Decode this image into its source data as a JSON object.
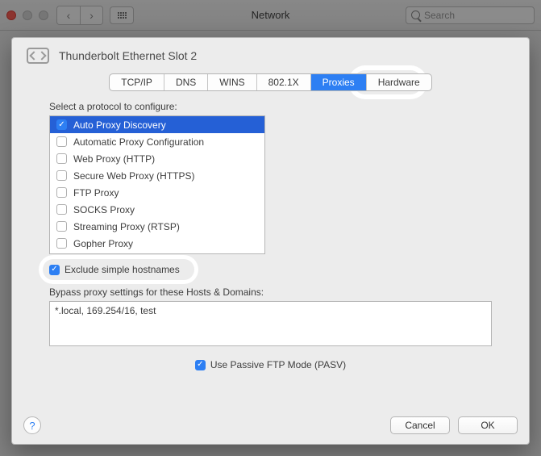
{
  "window": {
    "title": "Network",
    "search_placeholder": "Search"
  },
  "sheet": {
    "title": "Thunderbolt Ethernet Slot 2"
  },
  "tabs": [
    "TCP/IP",
    "DNS",
    "WINS",
    "802.1X",
    "Proxies",
    "Hardware"
  ],
  "active_tab": "Proxies",
  "protocol_label": "Select a protocol to configure:",
  "protocols": [
    {
      "label": "Auto Proxy Discovery",
      "checked": true,
      "selected": true
    },
    {
      "label": "Automatic Proxy Configuration",
      "checked": false,
      "selected": false
    },
    {
      "label": "Web Proxy (HTTP)",
      "checked": false,
      "selected": false
    },
    {
      "label": "Secure Web Proxy (HTTPS)",
      "checked": false,
      "selected": false
    },
    {
      "label": "FTP Proxy",
      "checked": false,
      "selected": false
    },
    {
      "label": "SOCKS Proxy",
      "checked": false,
      "selected": false
    },
    {
      "label": "Streaming Proxy (RTSP)",
      "checked": false,
      "selected": false
    },
    {
      "label": "Gopher Proxy",
      "checked": false,
      "selected": false
    }
  ],
  "exclude_simple": {
    "label": "Exclude simple hostnames",
    "checked": true
  },
  "bypass_label": "Bypass proxy settings for these Hosts & Domains:",
  "bypass_value": "*.local, 169.254/16, test",
  "passive_ftp": {
    "label": "Use Passive FTP Mode (PASV)",
    "checked": true
  },
  "buttons": {
    "cancel": "Cancel",
    "ok": "OK",
    "help": "?"
  }
}
